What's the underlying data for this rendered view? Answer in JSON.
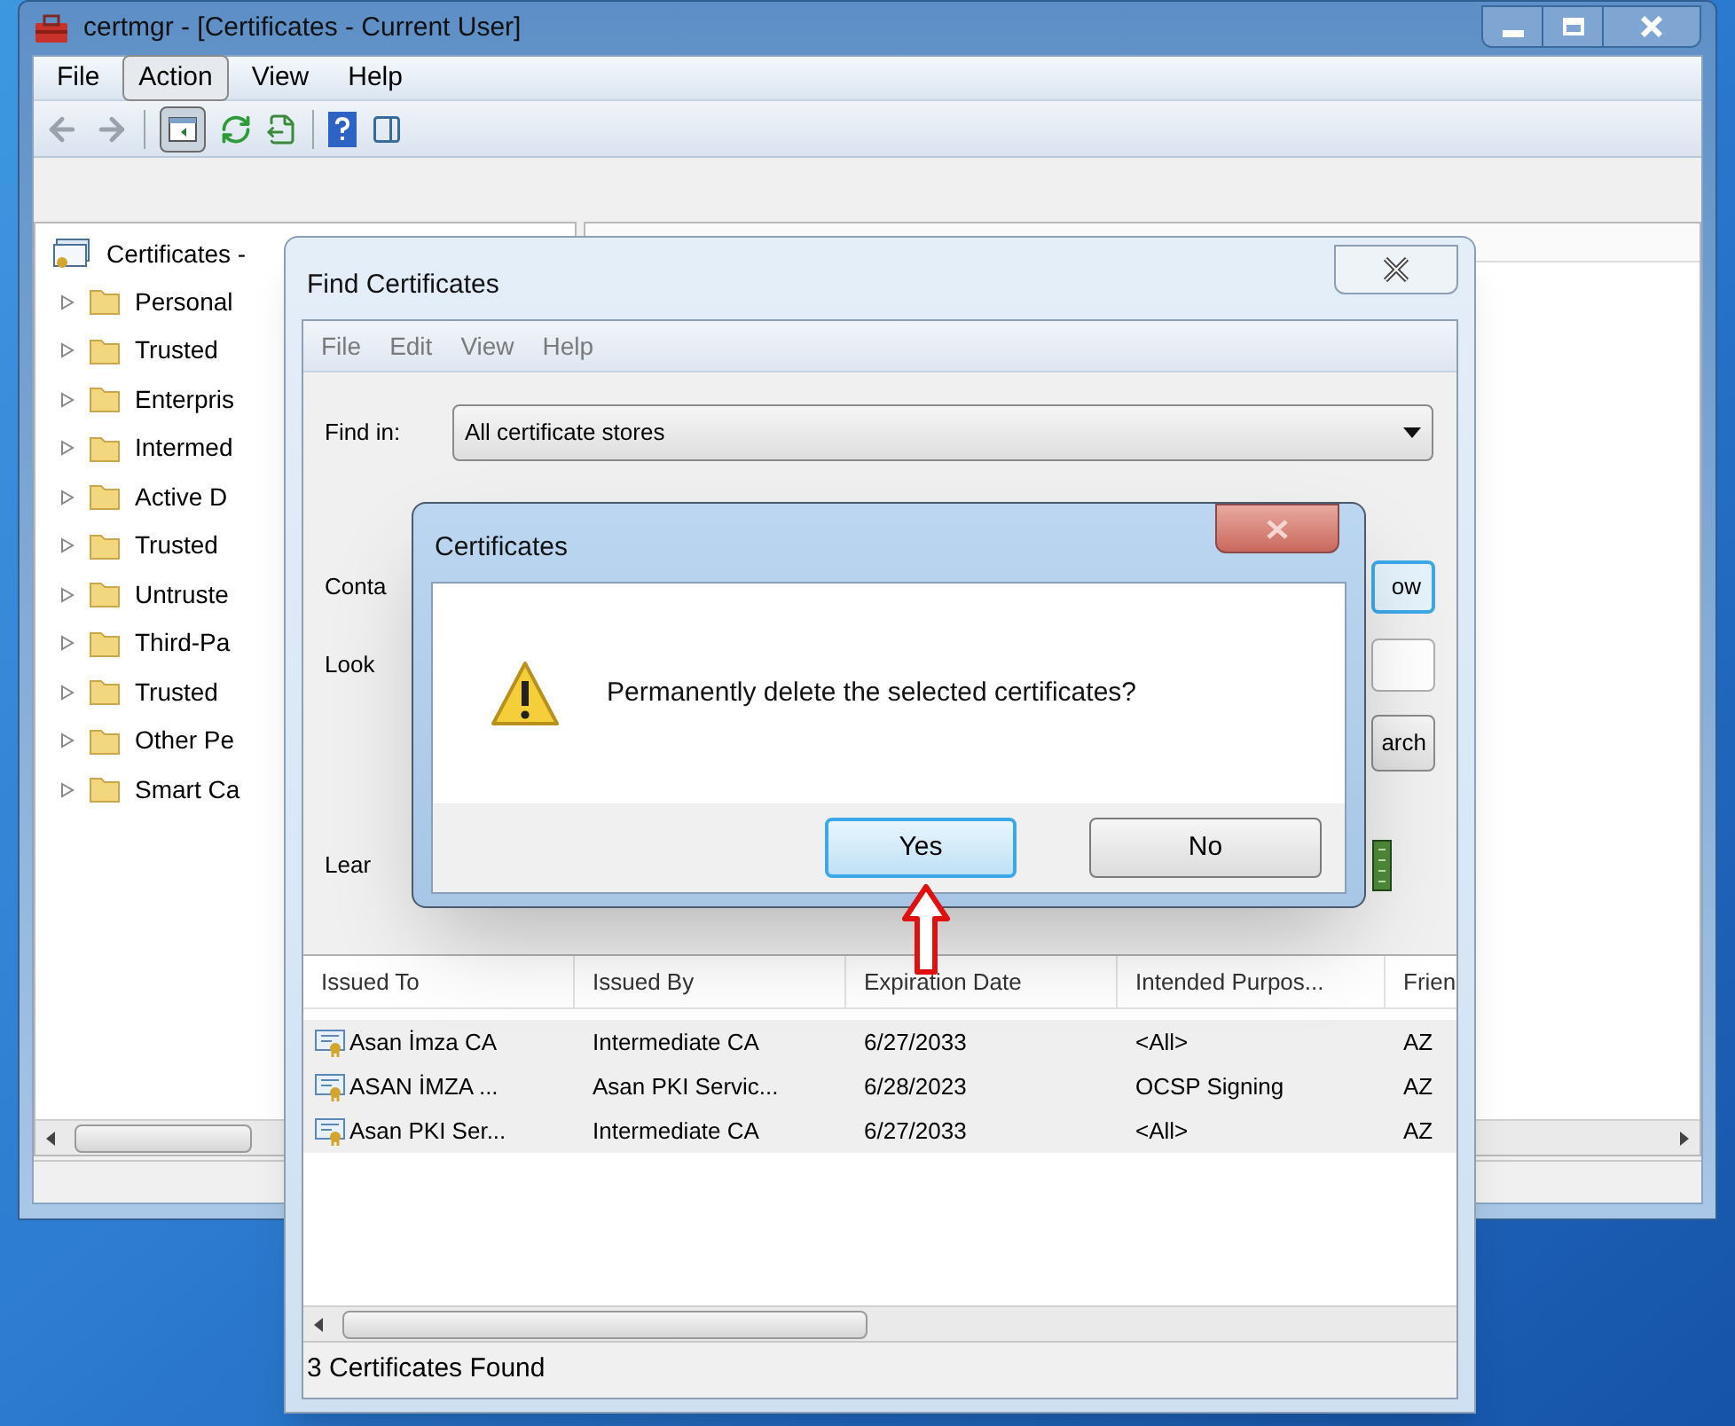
{
  "main_window": {
    "title": "certmgr - [Certificates - Current User]",
    "menu": [
      {
        "label": "File",
        "selected": false
      },
      {
        "label": "Action",
        "selected": true
      },
      {
        "label": "View",
        "selected": false
      },
      {
        "label": "Help",
        "selected": false
      }
    ],
    "tree": {
      "label": "Certificates -",
      "children": [
        {
          "label": "Personal",
          "expanded": false
        },
        {
          "label": "Trusted",
          "expanded": false
        },
        {
          "label": "Enterpris",
          "expanded": false
        },
        {
          "label": "Intermed",
          "expanded": false
        },
        {
          "label": "Active D",
          "expanded": false
        },
        {
          "label": "Trusted",
          "expanded": false
        },
        {
          "label": "Untruste",
          "expanded": false
        },
        {
          "label": "Third-Pa",
          "expanded": false
        },
        {
          "label": "Trusted",
          "expanded": false
        },
        {
          "label": "Other Pe",
          "expanded": false
        },
        {
          "label": "Smart Ca",
          "expanded": false
        }
      ]
    }
  },
  "find_dialog": {
    "title": "Find Certificates",
    "menu": [
      "File",
      "Edit",
      "View",
      "Help"
    ],
    "find_in_label": "Find in:",
    "find_in_value": "All certificate stores",
    "contains_label": "Conta",
    "look_label": "Look",
    "learn_label": "Lear",
    "find_now_button": "ow",
    "search_button": "arch",
    "columns": [
      "Issued To",
      "Issued By",
      "Expiration Date",
      "Intended Purpos...",
      "Frien"
    ],
    "rows": [
      {
        "selected": true,
        "cells": [
          "Asan İmza CA",
          "Intermediate CA",
          "6/27/2033",
          "<All>",
          "AZ"
        ]
      },
      {
        "selected": true,
        "cells": [
          "ASAN İMZA ...",
          "Asan PKI Servic...",
          "6/28/2023",
          "OCSP Signing",
          "AZ"
        ]
      },
      {
        "selected": true,
        "cells": [
          "Asan PKI Ser...",
          "Intermediate CA",
          "6/27/2033",
          "<All>",
          "AZ"
        ]
      }
    ],
    "status": "3 Certificates Found"
  },
  "confirm_dialog": {
    "title": "Certificates",
    "message": "Permanently delete the selected certificates?",
    "buttons": [
      {
        "label": "Yes",
        "focused": true
      },
      {
        "label": "No",
        "focused": false
      }
    ]
  }
}
